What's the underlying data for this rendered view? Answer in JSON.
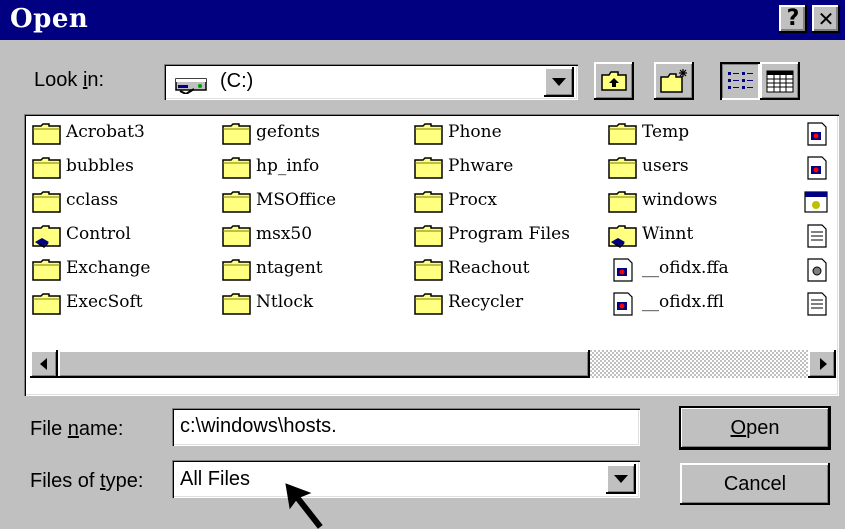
{
  "window": {
    "title": "Open",
    "help_button": "?",
    "close_button": "✕"
  },
  "look_in": {
    "label_pre": "Look ",
    "label_accel": "i",
    "label_post": "n:",
    "value": "(C:)"
  },
  "toolbar": {
    "up_one_level_icon": "up-folder-icon",
    "new_folder_icon": "new-folder-icon",
    "list_view_icon": "list-view-icon",
    "details_view_icon": "details-view-icon"
  },
  "files": {
    "col1": [
      "Acrobat3",
      "bubbles",
      "cclass",
      "Control",
      "Exchange",
      "ExecSoft"
    ],
    "col2": [
      "gefonts",
      "hp_info",
      "MSOffice",
      "msx50",
      "ntagent",
      "Ntlock"
    ],
    "col3": [
      "Phone",
      "Phware",
      "Procx",
      "Program Files",
      "Reachout",
      "Recycler"
    ],
    "col4": [
      "Temp",
      "users",
      "windows",
      "Winnt",
      "__ofidx.ffa",
      "__ofidx.ffl"
    ]
  },
  "file_name": {
    "label_pre": "File ",
    "label_accel": "n",
    "label_post": "ame:",
    "value": "c:\\windows\\hosts."
  },
  "file_type": {
    "label_pre": "Files of ",
    "label_accel": "t",
    "label_post": "ype:",
    "value": "All Files"
  },
  "buttons": {
    "open_accel": "O",
    "open_rest": "pen",
    "cancel": "Cancel"
  },
  "colors": {
    "titlebar": "#000080",
    "face": "#c0c0c0",
    "folder_yellow": "#ffff80"
  }
}
